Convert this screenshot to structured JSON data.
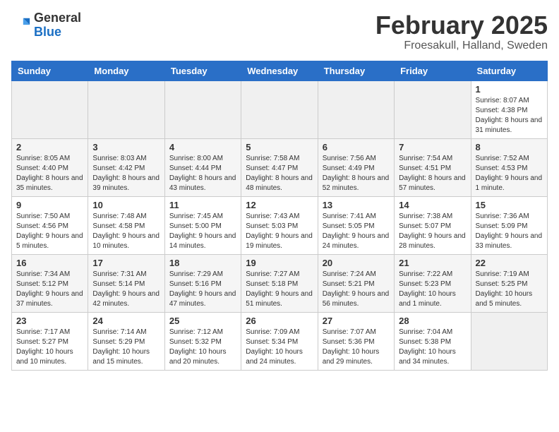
{
  "header": {
    "logo_general": "General",
    "logo_blue": "Blue",
    "month_title": "February 2025",
    "location": "Froesakull, Halland, Sweden"
  },
  "weekdays": [
    "Sunday",
    "Monday",
    "Tuesday",
    "Wednesday",
    "Thursday",
    "Friday",
    "Saturday"
  ],
  "weeks": [
    [
      {
        "day": "",
        "info": ""
      },
      {
        "day": "",
        "info": ""
      },
      {
        "day": "",
        "info": ""
      },
      {
        "day": "",
        "info": ""
      },
      {
        "day": "",
        "info": ""
      },
      {
        "day": "",
        "info": ""
      },
      {
        "day": "1",
        "info": "Sunrise: 8:07 AM\nSunset: 4:38 PM\nDaylight: 8 hours and 31 minutes."
      }
    ],
    [
      {
        "day": "2",
        "info": "Sunrise: 8:05 AM\nSunset: 4:40 PM\nDaylight: 8 hours and 35 minutes."
      },
      {
        "day": "3",
        "info": "Sunrise: 8:03 AM\nSunset: 4:42 PM\nDaylight: 8 hours and 39 minutes."
      },
      {
        "day": "4",
        "info": "Sunrise: 8:00 AM\nSunset: 4:44 PM\nDaylight: 8 hours and 43 minutes."
      },
      {
        "day": "5",
        "info": "Sunrise: 7:58 AM\nSunset: 4:47 PM\nDaylight: 8 hours and 48 minutes."
      },
      {
        "day": "6",
        "info": "Sunrise: 7:56 AM\nSunset: 4:49 PM\nDaylight: 8 hours and 52 minutes."
      },
      {
        "day": "7",
        "info": "Sunrise: 7:54 AM\nSunset: 4:51 PM\nDaylight: 8 hours and 57 minutes."
      },
      {
        "day": "8",
        "info": "Sunrise: 7:52 AM\nSunset: 4:53 PM\nDaylight: 9 hours and 1 minute."
      }
    ],
    [
      {
        "day": "9",
        "info": "Sunrise: 7:50 AM\nSunset: 4:56 PM\nDaylight: 9 hours and 5 minutes."
      },
      {
        "day": "10",
        "info": "Sunrise: 7:48 AM\nSunset: 4:58 PM\nDaylight: 9 hours and 10 minutes."
      },
      {
        "day": "11",
        "info": "Sunrise: 7:45 AM\nSunset: 5:00 PM\nDaylight: 9 hours and 14 minutes."
      },
      {
        "day": "12",
        "info": "Sunrise: 7:43 AM\nSunset: 5:03 PM\nDaylight: 9 hours and 19 minutes."
      },
      {
        "day": "13",
        "info": "Sunrise: 7:41 AM\nSunset: 5:05 PM\nDaylight: 9 hours and 24 minutes."
      },
      {
        "day": "14",
        "info": "Sunrise: 7:38 AM\nSunset: 5:07 PM\nDaylight: 9 hours and 28 minutes."
      },
      {
        "day": "15",
        "info": "Sunrise: 7:36 AM\nSunset: 5:09 PM\nDaylight: 9 hours and 33 minutes."
      }
    ],
    [
      {
        "day": "16",
        "info": "Sunrise: 7:34 AM\nSunset: 5:12 PM\nDaylight: 9 hours and 37 minutes."
      },
      {
        "day": "17",
        "info": "Sunrise: 7:31 AM\nSunset: 5:14 PM\nDaylight: 9 hours and 42 minutes."
      },
      {
        "day": "18",
        "info": "Sunrise: 7:29 AM\nSunset: 5:16 PM\nDaylight: 9 hours and 47 minutes."
      },
      {
        "day": "19",
        "info": "Sunrise: 7:27 AM\nSunset: 5:18 PM\nDaylight: 9 hours and 51 minutes."
      },
      {
        "day": "20",
        "info": "Sunrise: 7:24 AM\nSunset: 5:21 PM\nDaylight: 9 hours and 56 minutes."
      },
      {
        "day": "21",
        "info": "Sunrise: 7:22 AM\nSunset: 5:23 PM\nDaylight: 10 hours and 1 minute."
      },
      {
        "day": "22",
        "info": "Sunrise: 7:19 AM\nSunset: 5:25 PM\nDaylight: 10 hours and 5 minutes."
      }
    ],
    [
      {
        "day": "23",
        "info": "Sunrise: 7:17 AM\nSunset: 5:27 PM\nDaylight: 10 hours and 10 minutes."
      },
      {
        "day": "24",
        "info": "Sunrise: 7:14 AM\nSunset: 5:29 PM\nDaylight: 10 hours and 15 minutes."
      },
      {
        "day": "25",
        "info": "Sunrise: 7:12 AM\nSunset: 5:32 PM\nDaylight: 10 hours and 20 minutes."
      },
      {
        "day": "26",
        "info": "Sunrise: 7:09 AM\nSunset: 5:34 PM\nDaylight: 10 hours and 24 minutes."
      },
      {
        "day": "27",
        "info": "Sunrise: 7:07 AM\nSunset: 5:36 PM\nDaylight: 10 hours and 29 minutes."
      },
      {
        "day": "28",
        "info": "Sunrise: 7:04 AM\nSunset: 5:38 PM\nDaylight: 10 hours and 34 minutes."
      },
      {
        "day": "",
        "info": ""
      }
    ]
  ]
}
